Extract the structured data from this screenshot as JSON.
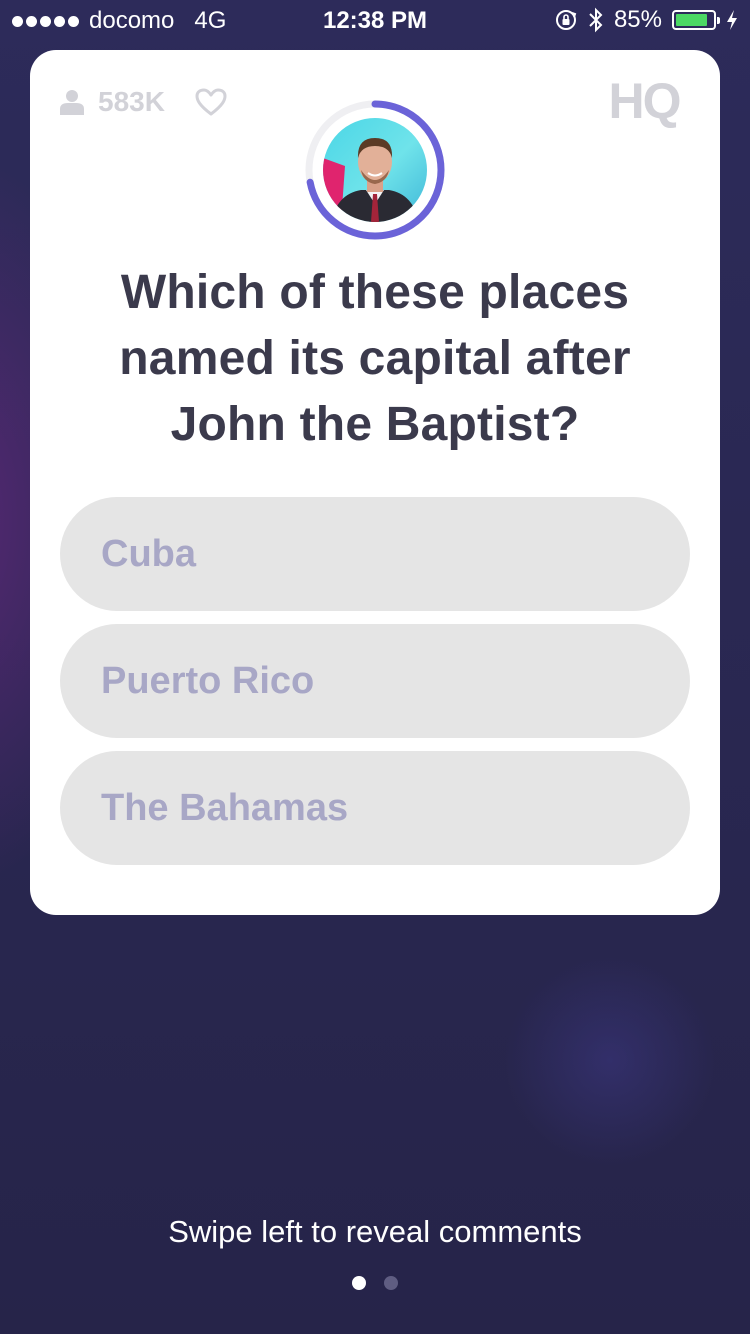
{
  "status_bar": {
    "carrier": "docomo",
    "network": "4G",
    "time": "12:38 PM",
    "battery": "85%",
    "battery_level": 0.85,
    "icons": [
      "signal-dots",
      "orientation-lock-icon",
      "bluetooth-icon",
      "battery-icon",
      "charging-bolt-icon"
    ]
  },
  "card": {
    "viewer_count": "583K",
    "logo_text": "HQ",
    "timer_progress": 0.72,
    "question": "Which of these places named its capital after John the Baptist?",
    "answers": [
      {
        "label": "Cuba"
      },
      {
        "label": "Puerto Rico"
      },
      {
        "label": "The Bahamas"
      }
    ]
  },
  "footer": {
    "hint": "Swipe left to reveal comments",
    "pages": 2,
    "active_page": 1
  },
  "colors": {
    "background": "#27254e",
    "card": "#ffffff",
    "timer_ring": "#6b63d8",
    "answer_bg": "#e5e5e5",
    "answer_text": "#a8a7c6",
    "question_text": "#3b3a4c",
    "battery": "#4cd964"
  }
}
